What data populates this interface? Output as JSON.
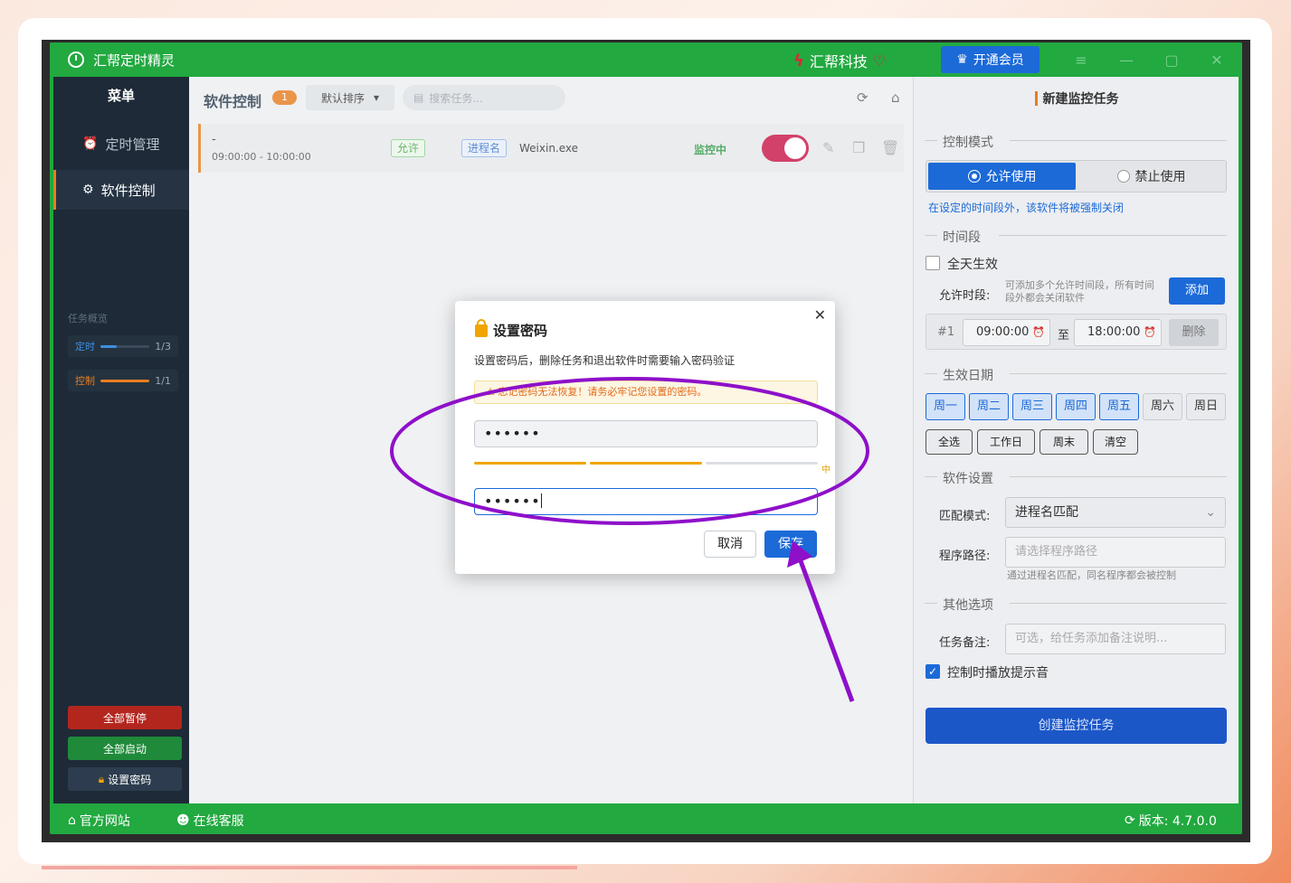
{
  "app": {
    "title": "汇帮定时精灵",
    "brand": "汇帮科技",
    "vip_label": "开通会员"
  },
  "sidebar": {
    "menu_title": "菜单",
    "items": [
      {
        "label": "定时管理",
        "icon": "alarm-clock-icon"
      },
      {
        "label": "软件控制",
        "icon": "gear-icon"
      }
    ],
    "overview_label": "任务概览",
    "overview": [
      {
        "label": "定时",
        "count": "1/3",
        "progress": 0.333,
        "color": "#3d8fe0"
      },
      {
        "label": "控制",
        "count": "1/1",
        "progress": 1.0,
        "color": "#e67e22"
      }
    ],
    "buttons": {
      "pause_all": "全部暂停",
      "start_all": "全部启动",
      "set_password": "设置密码"
    }
  },
  "main": {
    "title": "软件控制",
    "badge": "1",
    "sort_label": "默认排序",
    "search_placeholder": "搜索任务...",
    "task": {
      "name": "-",
      "time": "09:00:00 - 10:00:00",
      "mode_tag": "允许",
      "type_tag": "进程名",
      "exe": "Weixin.exe",
      "status": "监控中",
      "enabled": true
    }
  },
  "panel": {
    "title": "新建监控任务",
    "sections": {
      "control_mode": "控制模式",
      "time_period": "时间段",
      "effective_date": "生效日期",
      "software_settings": "软件设置",
      "other_options": "其他选项"
    },
    "mode_allow": "允许使用",
    "mode_forbid": "禁止使用",
    "mode_hint": "在设定的时间段外，该软件将被强制关闭",
    "all_day_label": "全天生效",
    "allowed_period_label": "允许时段:",
    "allowed_period_hint_1": "可添加多个允许时间段，所有时间",
    "allowed_period_hint_2": "段外都会关闭软件",
    "add_label": "添加",
    "time_slot": {
      "index": "#1",
      "start": "09:00:00",
      "to": "至",
      "end": "18:00:00",
      "delete": "删除"
    },
    "days": [
      {
        "label": "周一",
        "selected": true
      },
      {
        "label": "周二",
        "selected": true
      },
      {
        "label": "周三",
        "selected": true
      },
      {
        "label": "周四",
        "selected": true
      },
      {
        "label": "周五",
        "selected": true
      },
      {
        "label": "周六",
        "selected": false
      },
      {
        "label": "周日",
        "selected": false
      }
    ],
    "quick": [
      "全选",
      "工作日",
      "周末",
      "清空"
    ],
    "match_mode_label": "匹配模式:",
    "match_mode_value": "进程名匹配",
    "program_path_label": "程序路径:",
    "program_path_placeholder": "请选择程序路径",
    "program_path_hint": "通过进程名匹配，同名程序都会被控制",
    "note_label": "任务备注:",
    "note_placeholder": "可选，给任务添加备注说明...",
    "sound_label": "控制时播放提示音",
    "sound_checked": true,
    "create_label": "创建监控任务"
  },
  "footer": {
    "website": "官方网站",
    "support": "在线客服",
    "version": "版本: 4.7.0.0"
  },
  "dialog": {
    "title": "设置密码",
    "description": "设置密码后，删除任务和退出软件时需要输入密码验证",
    "warning": "忘记密码无法恢复！请务必牢记您设置的密码。",
    "password": "••••••",
    "confirm": "••••••",
    "strength_label": "中",
    "cancel": "取消",
    "save": "保存"
  },
  "annotation": {
    "color": "#8e10c9"
  }
}
